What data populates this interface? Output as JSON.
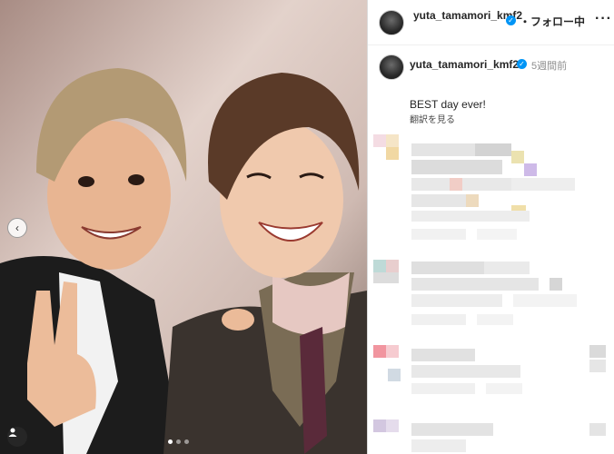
{
  "post": {
    "username": "yuta_tamamori_kmf2",
    "verified_mark": "✓",
    "follow_status": "・フォロー中",
    "more_label": "···",
    "timestamp": "5週間前",
    "caption": "BEST day ever!",
    "translate_label": "翻訳を見る"
  },
  "carousel": {
    "prev_icon": "‹",
    "dots": [
      true,
      false,
      false
    ]
  },
  "colors": {
    "verified_blue": "#0095f6",
    "text_primary": "#262626",
    "text_secondary": "#8e8e8e"
  }
}
